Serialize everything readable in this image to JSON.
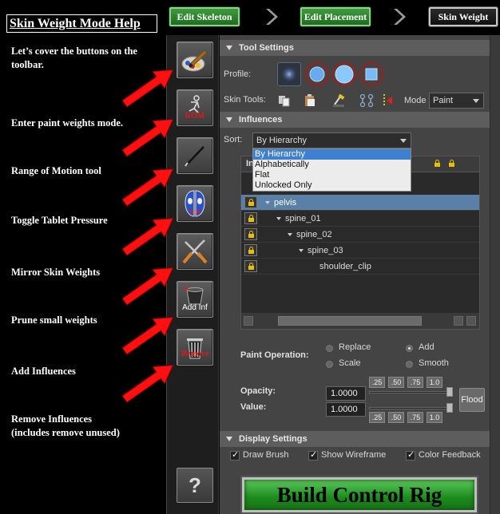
{
  "workflow": {
    "edit_skeleton": "Edit Skeleton",
    "edit_placement": "Edit Placement",
    "skin_weight": "Skin Weight"
  },
  "help": {
    "title": "Skin Weight Mode Help",
    "intro": "Let’s cover the buttons on the toolbar.",
    "items": [
      "Enter paint weights mode.",
      "Range of Motion tool",
      "Toggle Tablet Pressure",
      "Mirror Skin Weights",
      "Prune small weights",
      "Add Influences",
      "Remove Influences",
      "(includes remove unused)"
    ]
  },
  "toolbar": {
    "rom_label": "ROM",
    "add_inf_label": "Add Inf",
    "remove_label": "Remove",
    "help_label": "?"
  },
  "tool_settings": {
    "header": "Tool Settings",
    "profile_label": "Profile:",
    "skin_tools_label": "Skin Tools:",
    "mode_label": "Mode",
    "mode_value": "Paint"
  },
  "influences": {
    "header": "Influences",
    "sort_label": "Sort:",
    "sort_value": "By Hierarchy",
    "sort_options": [
      "By Hierarchy",
      "Alphabetically",
      "Flat",
      "Unlocked Only"
    ],
    "column_header_partial": "In",
    "joints": [
      "pelvis",
      "spine_01",
      "spine_02",
      "spine_03",
      "shoulder_clip"
    ]
  },
  "paint": {
    "operation_label": "Paint Operation:",
    "ops": [
      "Replace",
      "Add",
      "Scale",
      "Smooth"
    ],
    "selected_op": "Add",
    "opacity_label": "Opacity:",
    "value_label": "Value:",
    "opacity_value": "1.0000",
    "value_value": "1.0000",
    "presets": [
      ".25",
      ".50",
      ".75",
      "1.0"
    ],
    "flood_label": "Flood"
  },
  "display": {
    "header": "Display Settings",
    "draw_brush": "Draw Brush",
    "show_wireframe": "Show Wireframe",
    "color_feedback": "Color Feedback"
  },
  "build_button": "Build Control Rig",
  "colors": {
    "accent_green": "#1d8a1d",
    "arrow_red": "#ff1010",
    "selection_blue": "#5a80a8"
  }
}
